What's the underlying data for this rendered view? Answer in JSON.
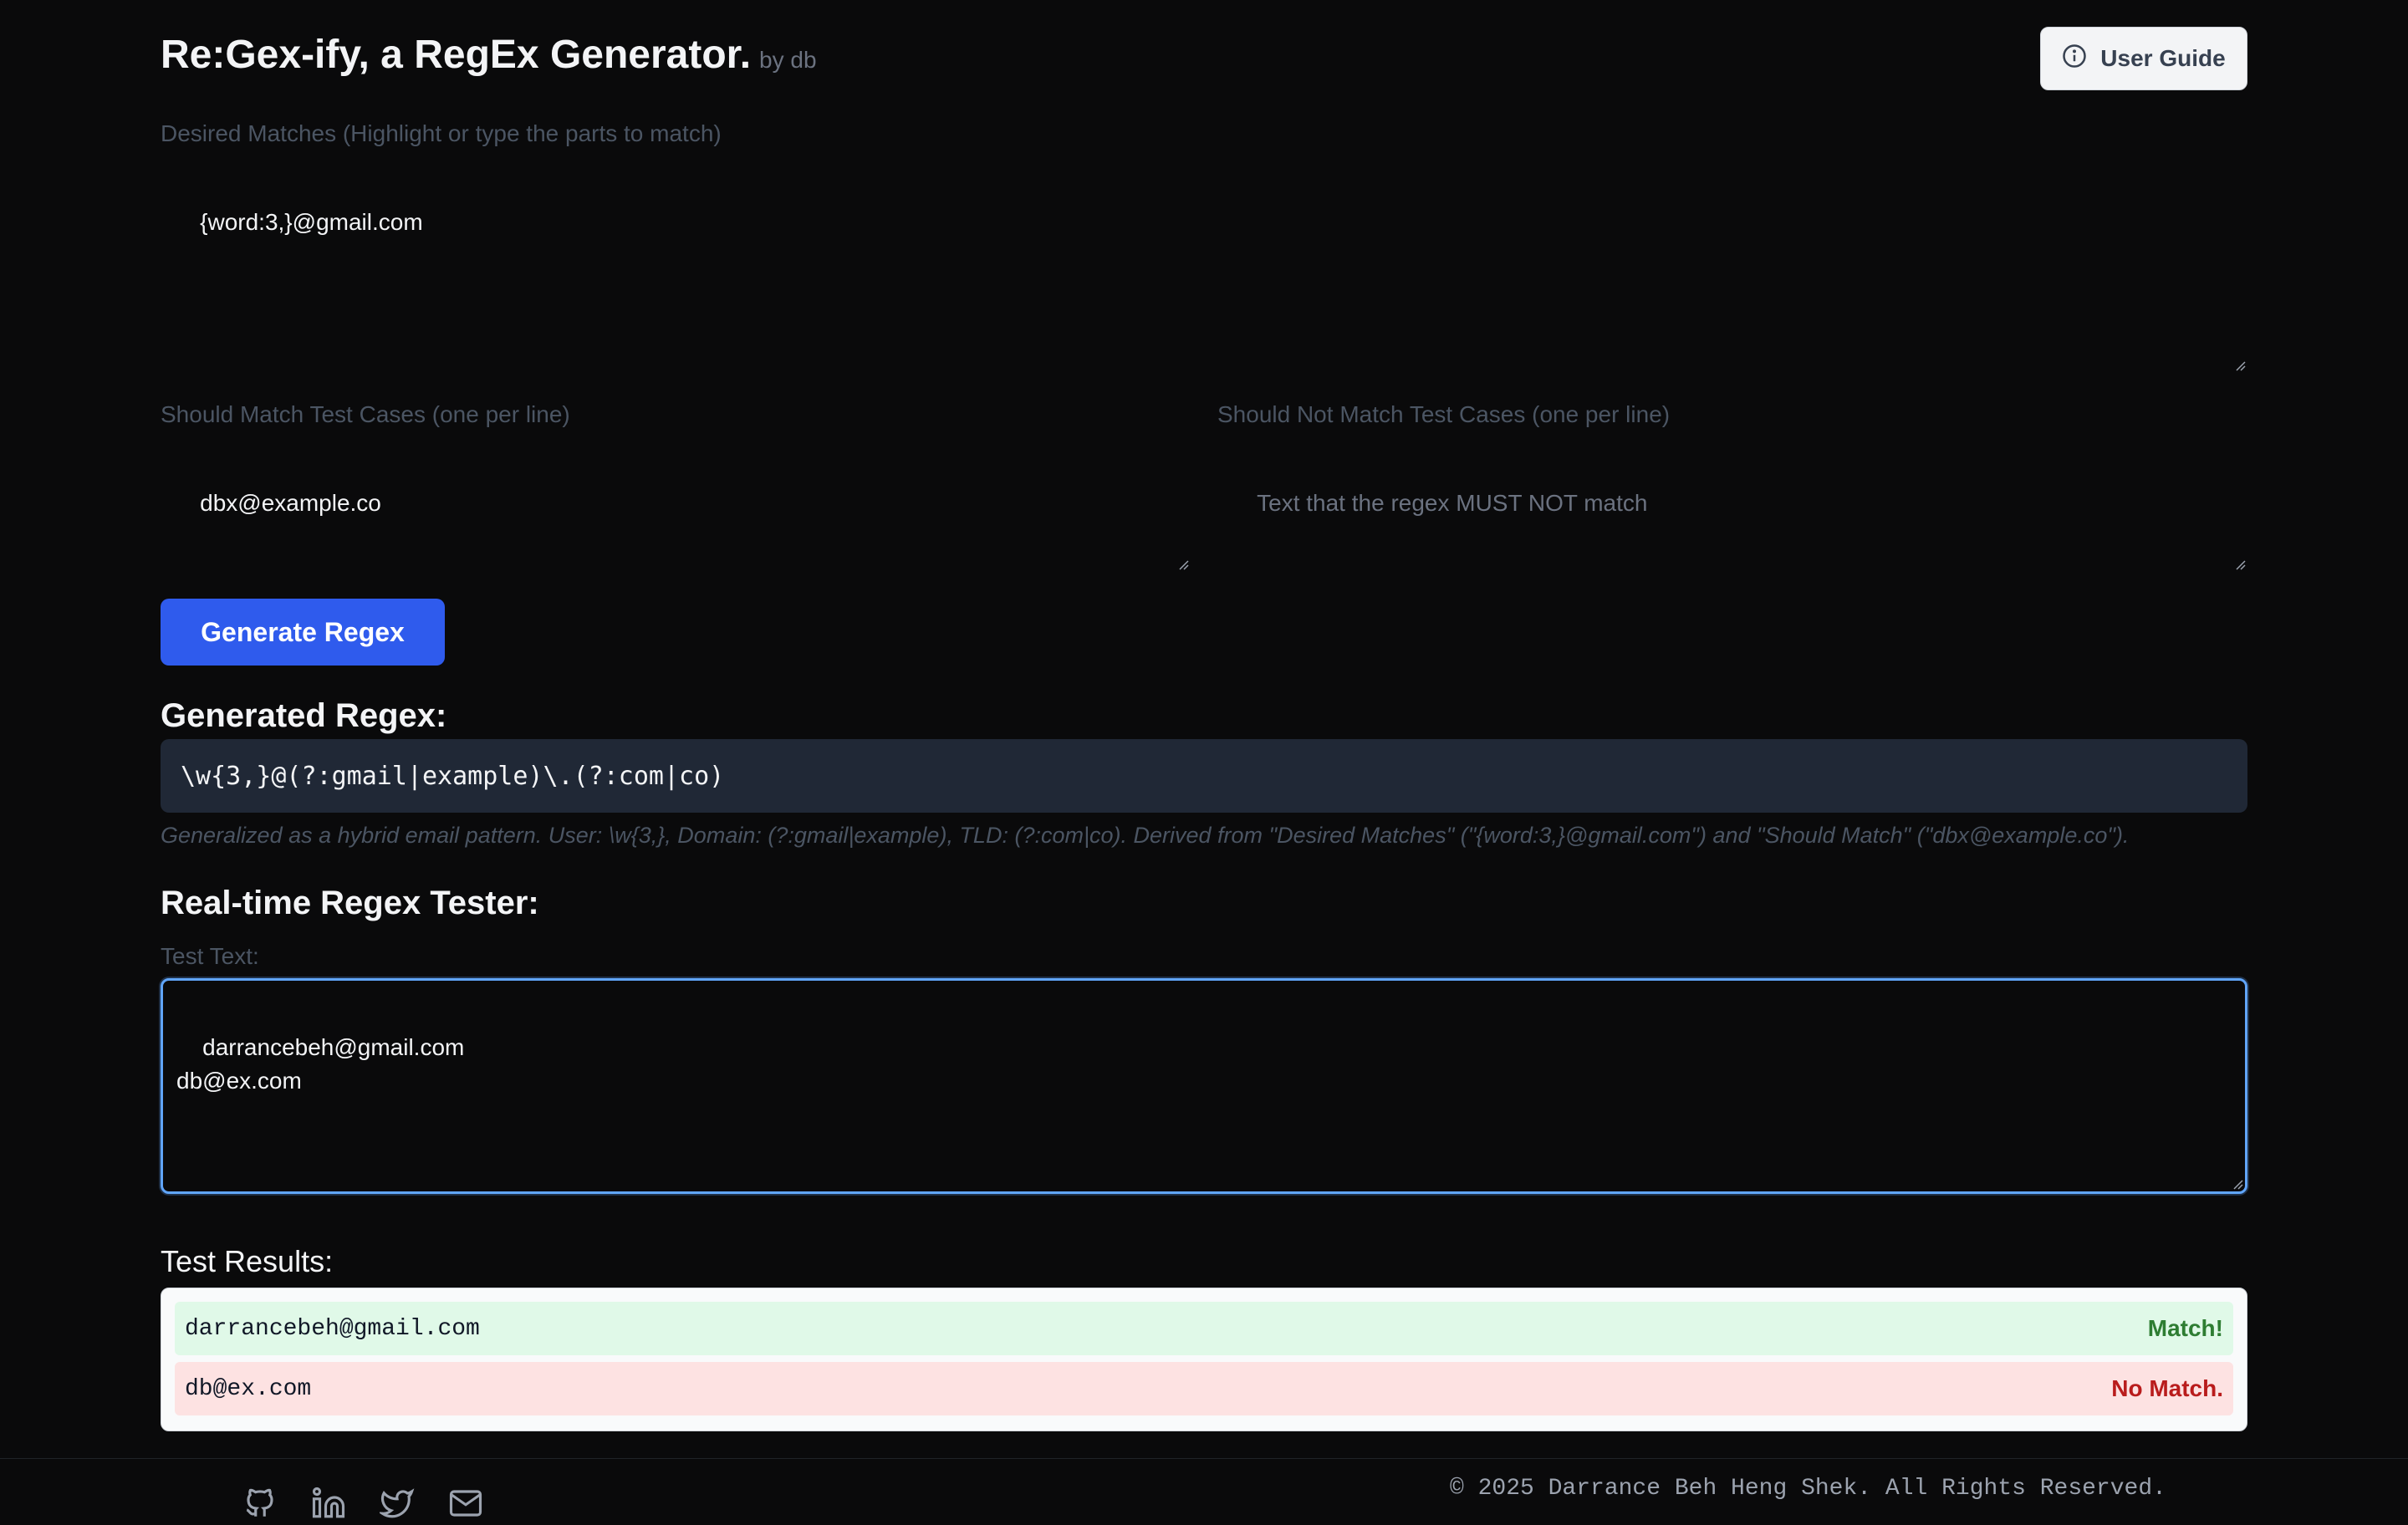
{
  "header": {
    "title": "Re:Gex-ify, a RegEx Generator.",
    "byline": "by db",
    "guide_button": "User Guide"
  },
  "desired": {
    "label": "Desired Matches (Highlight or type the parts to match)",
    "value": "{word:3,}@gmail.com"
  },
  "should_match": {
    "label": "Should Match Test Cases (one per line)",
    "value": "dbx@example.co"
  },
  "should_not_match": {
    "label": "Should Not Match Test Cases (one per line)",
    "placeholder": "Text that the regex MUST NOT match"
  },
  "generate_button": "Generate Regex",
  "generated": {
    "heading": "Generated Regex:",
    "regex": "\\w{3,}@(?:gmail|example)\\.(?:com|co)",
    "explanation": "Generalized as a hybrid email pattern. User: \\w{3,}, Domain: (?:gmail|example), TLD: (?:com|co). Derived from \"Desired Matches\" (\"{word:3,}@gmail.com\") and \"Should Match\" (\"dbx@example.co\")."
  },
  "tester": {
    "heading": "Real-time Regex Tester:",
    "test_label": "Test Text:",
    "test_value": "darrancebeh@gmail.com\ndb@ex.com"
  },
  "results": {
    "heading": "Test Results:",
    "rows": [
      {
        "text": "darrancebeh@gmail.com",
        "status": "Match!"
      },
      {
        "text": "db@ex.com",
        "status": "No Match."
      }
    ]
  },
  "footer": {
    "icons": [
      "github-icon",
      "linkedin-icon",
      "twitter-icon",
      "mail-icon"
    ],
    "copyright": "© 2025 Darrance Beh Heng Shek. All Rights Reserved."
  },
  "colors": {
    "background": "#0a0a0b",
    "accent": "#2f5bed",
    "match_bg": "#e0f9e8",
    "match_text": "#2e7d32",
    "nomatch_bg": "#fde2e2",
    "nomatch_text": "#b91c1c"
  }
}
